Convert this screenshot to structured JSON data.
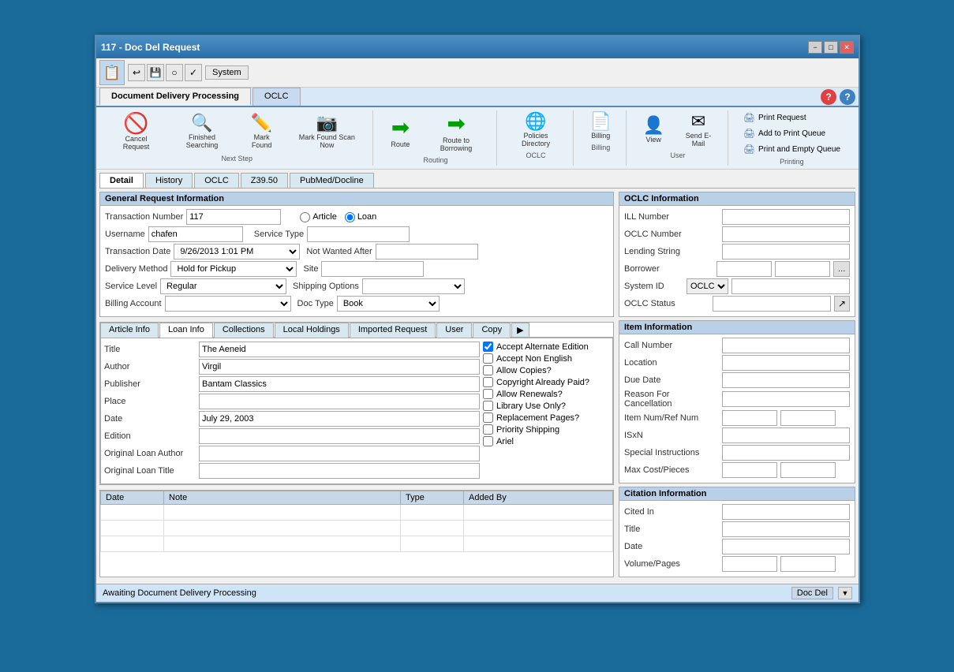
{
  "window": {
    "title": "117 - Doc Del Request",
    "minimize": "−",
    "maximize": "□",
    "close": "✕"
  },
  "menubar": {
    "system_label": "System",
    "tab1_label": "Document Delivery Processing",
    "tab2_label": "OCLC"
  },
  "toolbar": {
    "cancel_request": "Cancel\nRequest",
    "finished_searching": "Finished\nSearching",
    "mark_found": "Mark\nFound",
    "mark_found_scan": "Mark Found\nScan Now",
    "route": "Route",
    "route_to_borrowing": "Route to\nBorrowing",
    "policies_directory": "Policies\nDirectory",
    "billing": "Billing",
    "view": "View",
    "send_email": "Send E-Mail",
    "next_step_label": "Next Step",
    "routing_label": "Routing",
    "oclc_label": "OCLC",
    "billing_label": "Billing",
    "user_label": "User",
    "printing_label": "Printing",
    "print_request": "Print Request",
    "add_to_print_queue": "Add to Print Queue",
    "print_and_empty_queue": "Print and Empty Queue"
  },
  "detail_tabs": {
    "tab_detail": "Detail",
    "tab_history": "History",
    "tab_oclc": "OCLC",
    "tab_z3950": "Z39.50",
    "tab_pubmed": "PubMed/Docline"
  },
  "general_request": {
    "title": "General Request Information",
    "transaction_number_label": "Transaction Number",
    "transaction_number_value": "117",
    "username_label": "Username",
    "username_value": "chafen",
    "transaction_date_label": "Transaction Date",
    "transaction_date_value": "9/26/2013 1:01 PM",
    "delivery_method_label": "Delivery Method",
    "delivery_method_value": "Hold for Pickup",
    "service_level_label": "Service Level",
    "service_level_value": "Regular",
    "billing_account_label": "Billing Account",
    "billing_account_value": "",
    "article_radio": "Article",
    "loan_radio": "Loan",
    "service_type_label": "Service Type",
    "service_type_value": "",
    "not_wanted_after_label": "Not Wanted After",
    "not_wanted_after_value": "",
    "site_label": "Site",
    "site_value": "",
    "shipping_options_label": "Shipping Options",
    "shipping_options_value": "",
    "doc_type_label": "Doc Type",
    "doc_type_value": "Book"
  },
  "oclc_info": {
    "title": "OCLC Information",
    "ill_number_label": "ILL Number",
    "ill_number_value": "",
    "oclc_number_label": "OCLC Number",
    "oclc_number_value": "",
    "lending_string_label": "Lending String",
    "lending_string_value": "",
    "borrower_label": "Borrower",
    "borrower_value": "",
    "borrower_extra": "",
    "system_id_label": "System ID",
    "system_id_value": "OCLC",
    "oclc_status_label": "OCLC Status",
    "oclc_status_value": ""
  },
  "loan_tabs": {
    "article_info": "Article Info",
    "loan_info": "Loan Info",
    "collections": "Collections",
    "local_holdings": "Local Holdings",
    "imported_request": "Imported Request",
    "user": "User",
    "copy": "Copy"
  },
  "loan_info": {
    "title_label": "Title",
    "title_value": "The Aeneid",
    "author_label": "Author",
    "author_value": "Virgil",
    "publisher_label": "Publisher",
    "publisher_value": "Bantam Classics",
    "place_label": "Place",
    "place_value": "",
    "date_label": "Date",
    "date_value": "July 29, 2003",
    "edition_label": "Edition",
    "edition_value": "",
    "original_loan_author_label": "Original Loan Author",
    "original_loan_author_value": "",
    "original_loan_title_label": "Original Loan Title",
    "original_loan_title_value": ""
  },
  "checkboxes": {
    "accept_alternate_edition": "Accept Alternate Edition",
    "accept_non_english": "Accept Non English",
    "allow_copies": "Allow Copies?",
    "copyright_already_paid": "Copyright Already Paid?",
    "allow_renewals": "Allow Renewals?",
    "library_use_only": "Library Use Only?",
    "replacement_pages": "Replacement Pages?",
    "priority_shipping": "Priority Shipping",
    "ariel": "Ariel"
  },
  "notes_table": {
    "date_header": "Date",
    "note_header": "Note",
    "type_header": "Type",
    "added_by_header": "Added By"
  },
  "item_information": {
    "title": "Item Information",
    "call_number_label": "Call Number",
    "call_number_value": "",
    "location_label": "Location",
    "location_value": "",
    "due_date_label": "Due Date",
    "due_date_value": "",
    "reason_cancellation_label": "Reason For Cancellation",
    "reason_cancellation_value": "",
    "item_num_ref_label": "Item Num/Ref Num",
    "item_num_value": "",
    "ref_num_value": "",
    "isxn_label": "ISxN",
    "isxn_value": "",
    "special_instructions_label": "Special Instructions",
    "special_instructions_value": "",
    "max_cost_pieces_label": "Max Cost/Pieces",
    "max_cost_value": "",
    "pieces_value": ""
  },
  "citation_information": {
    "title": "Citation Information",
    "cited_in_label": "Cited In",
    "cited_in_value": "",
    "title_label": "Title",
    "title_value": "",
    "date_label": "Date",
    "date_value": "",
    "volume_pages_label": "Volume/Pages",
    "volume_value": "",
    "pages_value": ""
  },
  "status_bar": {
    "status_text": "Awaiting Document Delivery Processing",
    "badge_text": "Doc Del",
    "expand_icon": "▼"
  }
}
